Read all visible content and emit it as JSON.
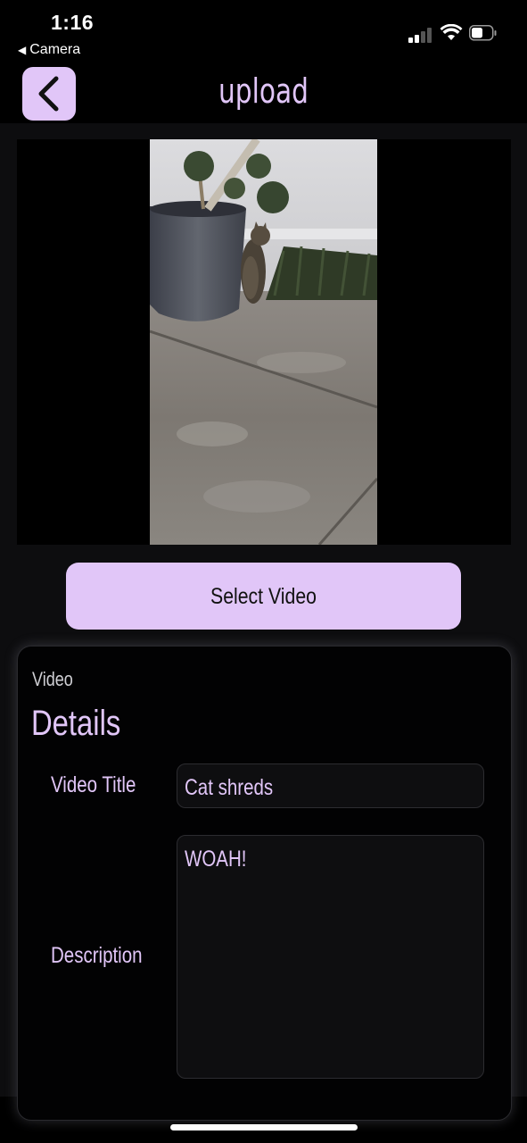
{
  "status_bar": {
    "time": "1:16",
    "back_app": "Camera",
    "back_arrow": "◀"
  },
  "header": {
    "title": "upload",
    "back_icon": "chevron-left-icon"
  },
  "preview": {
    "subject": "video preview frame"
  },
  "select_button_label": "Select Video",
  "details": {
    "kicker": "Video",
    "title": "Details",
    "video_title_label": "Video Title",
    "video_title_value": "Cat shreds",
    "description_label": "Description",
    "description_value": "WOAH!"
  },
  "colors": {
    "accent": "#e1c6f8",
    "background": "#000000",
    "panel": "#0d0d0f"
  }
}
